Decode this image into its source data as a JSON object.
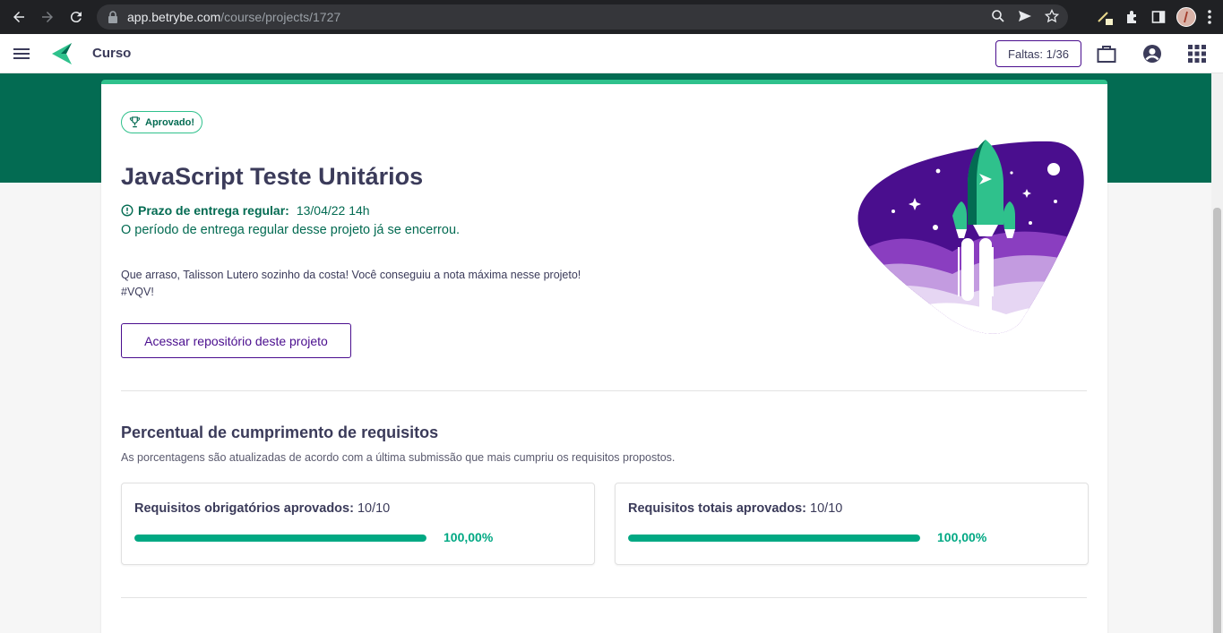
{
  "browser": {
    "url_host": "app.betrybe.com",
    "url_path": "/course/projects/1727",
    "icons": [
      "back-icon",
      "forward-icon",
      "reload-icon",
      "lock-icon",
      "zoom-icon",
      "send-icon",
      "star-icon",
      "pen-icon",
      "extension-icon",
      "sidebar-icon",
      "profile-icon",
      "kebab-icon"
    ]
  },
  "header": {
    "title": "Curso",
    "absence_label": "Faltas: 1/36",
    "icons": [
      "menu-icon",
      "trybe-logo",
      "briefcase-icon",
      "account-icon",
      "apps-grid-icon"
    ]
  },
  "project": {
    "badge": "Aprovado!",
    "title": "JavaScript Teste Unitários",
    "deadline_label": "Prazo de entrega regular:",
    "deadline_value": "13/04/22 14h",
    "closed_note": "O período de entrega regular desse projeto já se encerrou.",
    "message_line1": "Que arraso, Talisson Lutero sozinho da costa! Você conseguiu a nota máxima nesse projeto!",
    "message_line2": "#VQV!",
    "repo_button": "Acessar repositório deste projeto"
  },
  "requirements": {
    "title": "Percentual de cumprimento de requisitos",
    "subtitle": "As porcentagens são atualizadas de acordo com a última submissão que mais cumpriu os requisitos propostos.",
    "mandatory": {
      "label": "Requisitos obrigatórios aprovados:",
      "value": "10/10",
      "percent_text": "100,00%",
      "fill_percent": 100
    },
    "total": {
      "label": "Requisitos totais aprovados:",
      "value": "10/10",
      "percent_text": "100,00%",
      "fill_percent": 100
    }
  },
  "colors": {
    "brand_green": "#036b52",
    "accent_green": "#2fc18c",
    "progress_green": "#00a883",
    "purple": "#4a0e8e"
  }
}
